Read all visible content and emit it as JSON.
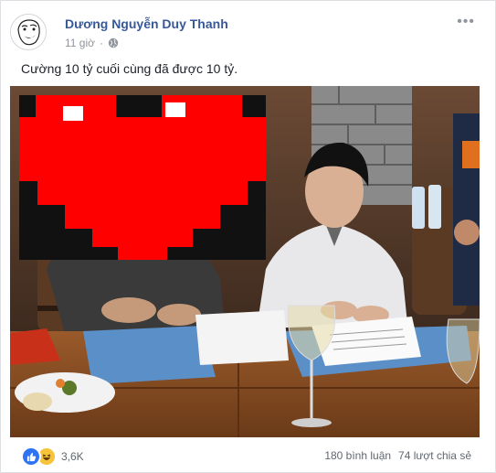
{
  "post": {
    "author": "Dương Nguyễn Duy Thanh",
    "time": "11 giờ",
    "separator": "·",
    "privacy_icon": "globe-icon",
    "more_label": "•••",
    "text": "Cường 10 tỷ cuối cùng đã được 10 tỷ."
  },
  "photo": {
    "description_icons": [
      "pixel-heart-icon"
    ]
  },
  "footer": {
    "reaction_icons": [
      "like-icon",
      "haha-icon"
    ],
    "reaction_count": "3,6K",
    "comments": "180 bình luận",
    "shares": "74 lượt chia sẻ"
  },
  "colors": {
    "author_link": "#385898",
    "like_blue": "#2e74f2",
    "haha_yellow": "#f7c33b",
    "heart_red": "#ff0000"
  }
}
